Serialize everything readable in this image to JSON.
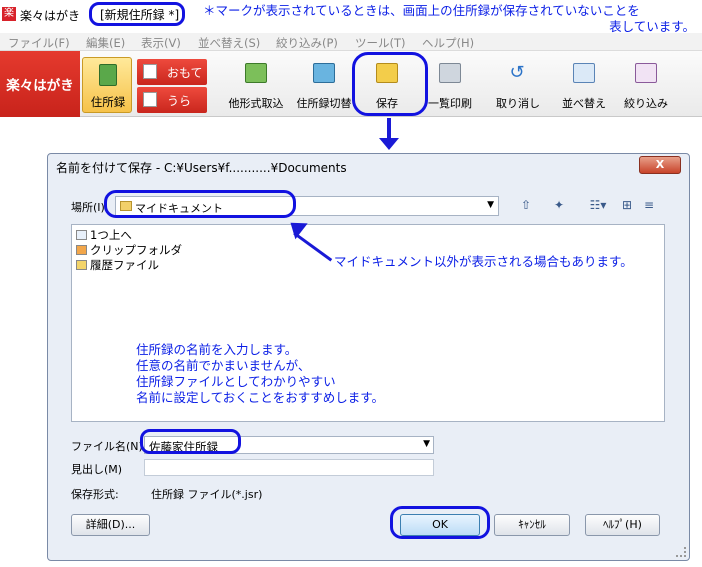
{
  "app": {
    "name": "楽々はがき",
    "doc_title": "[新規住所録 *]",
    "top_note_line1": "＊マークが表示されているときは、画面上の住所録が保存されていないことを",
    "top_note_line2": "表しています。"
  },
  "menu": [
    "ファイル(F)",
    "編集(E)",
    "表示(V)",
    "並べ替え(S)",
    "絞り込み(P)",
    "ツール(T)",
    "ヘルプ(H)"
  ],
  "ribbon": {
    "logo": "楽々はがき",
    "address_book": "住所録",
    "front": "おもて",
    "back": "うら",
    "buttons": [
      "他形式取込",
      "住所録切替",
      "保存",
      "一覧印刷",
      "取り消し",
      "並べ替え",
      "絞り込み"
    ]
  },
  "dialog": {
    "title": "名前を付けて保存 - C:¥Users¥f...........¥Documents",
    "close": "X",
    "location_label": "場所(I)",
    "location_value": "マイドキュメント",
    "list_items": [
      "1つ上へ",
      "クリップフォルダ",
      "履歴ファイル"
    ],
    "filename_label": "ファイル名(N)",
    "filename_value": "佐藤家住所録",
    "heading_label": "見出し(M)",
    "heading_value": "",
    "format_label": "保存形式:",
    "format_value": "住所録 ファイル(*.jsr)",
    "details_button": "詳細(D)...",
    "ok_button": "OK",
    "cancel_button": "ｷｬﾝｾﾙ",
    "help_button": "ﾍﾙﾌﾟ(H)"
  },
  "annotations": {
    "location_note": "マイドキュメント以外が表示される場合もあります。",
    "name_note": [
      "住所録の名前を入力します。",
      "任意の名前でかまいませんが、",
      "住所録ファイルとしてわかりやすい",
      "名前に設定しておくことをおすすめします。"
    ]
  },
  "colors": {
    "annotation": "#0a1ee6",
    "brand": "#d8222a"
  }
}
